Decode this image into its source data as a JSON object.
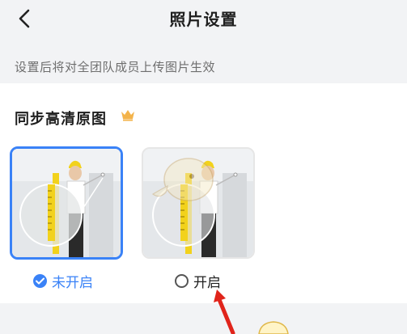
{
  "header": {
    "title": "照片设置",
    "back_icon": "chevron-left-icon"
  },
  "hint": "设置后将对全团队成员上传图片生效",
  "section": {
    "title": "同步高清原图",
    "badge_icon": "crown-icon",
    "badge_color": "#f3b34a"
  },
  "options": [
    {
      "label": "未开启",
      "selected": true
    },
    {
      "label": "开启",
      "selected": false
    }
  ],
  "accent_color": "#3a82f7",
  "annotation_color": "#e0241b"
}
